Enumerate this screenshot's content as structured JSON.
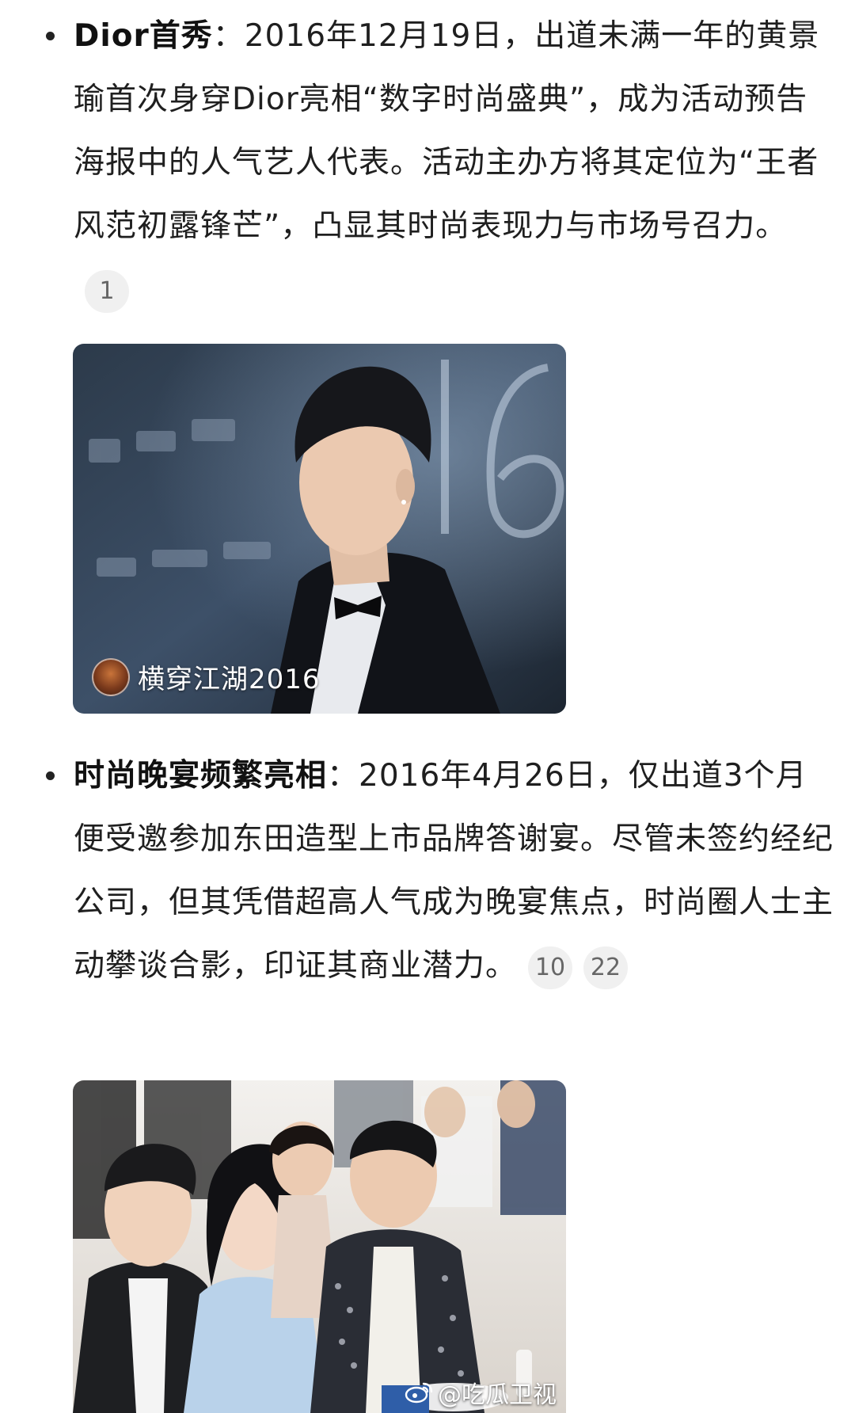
{
  "items": [
    {
      "title": "Dior首秀",
      "body": "：2016年12月19日，出道未满一年的黄景瑜首次身穿Dior亮相“数字时尚盛典”，成为活动预告海报中的人气艺人代表。活动主办方将其定位为“王者风范初露锋芒”，凸显其时尚表现力与市场号召力。",
      "citations": [
        "1"
      ],
      "image": {
        "credit": "横穿江湖2016"
      }
    },
    {
      "title": "时尚晚宴频繁亮相",
      "body": "：2016年4月26日，仅出道3个月便受邀参加东田造型上市品牌答谢宴。尽管未签约经纪公司，但其凭借超高人气成为晚宴焦点，时尚圈人士主动攀谈合影，印证其商业潜力。",
      "citations": [
        "10",
        "22"
      ]
    }
  ],
  "watermark": {
    "text": "@吃瓜卫视",
    "icon": "weibo-icon"
  },
  "colors": {
    "text": "#1f1f1f",
    "citation_bg": "#f0f0f0",
    "citation_text": "#666666"
  }
}
